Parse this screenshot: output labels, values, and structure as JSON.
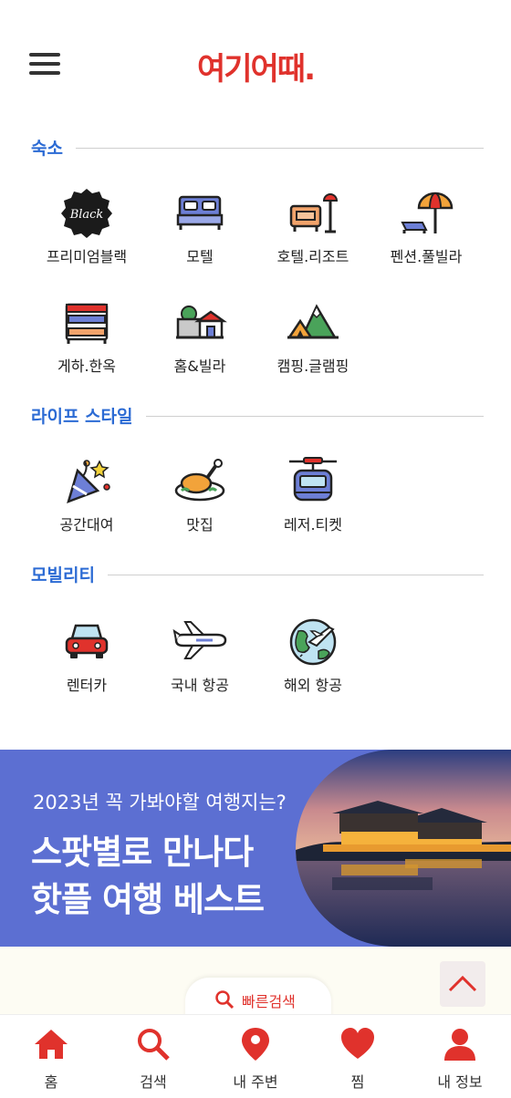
{
  "app": {
    "logo_text": "여기어때."
  },
  "sections": [
    {
      "title": "숙소",
      "items": [
        {
          "label": "프리미엄블랙",
          "icon": "black-badge-icon",
          "badge_text": "Black"
        },
        {
          "label": "모텔",
          "icon": "bed-icon"
        },
        {
          "label": "호텔.리조트",
          "icon": "sofa-lamp-icon"
        },
        {
          "label": "펜션.풀빌라",
          "icon": "beach-umbrella-icon"
        },
        {
          "label": "게하.한옥",
          "icon": "bunk-bed-icon"
        },
        {
          "label": "홈&빌라",
          "icon": "house-icon"
        },
        {
          "label": "캠핑.글램핑",
          "icon": "tent-mountain-icon"
        }
      ]
    },
    {
      "title": "라이프 스타일",
      "items": [
        {
          "label": "공간대여",
          "icon": "party-popper-icon"
        },
        {
          "label": "맛집",
          "icon": "roast-chicken-icon"
        },
        {
          "label": "레저.티켓",
          "icon": "cable-car-icon"
        }
      ]
    },
    {
      "title": "모빌리티",
      "items": [
        {
          "label": "렌터카",
          "icon": "car-icon"
        },
        {
          "label": "국내 항공",
          "icon": "airplane-icon"
        },
        {
          "label": "해외 항공",
          "icon": "globe-plane-icon"
        }
      ]
    }
  ],
  "banner": {
    "subtitle": "2023년 꼭 가봐야할 여행지는?",
    "title_line1": "스팟별로 만나다",
    "title_line2": "핫플 여행 베스트",
    "background_color": "#5c6fd2"
  },
  "quick_search": {
    "label": "빠른검색"
  },
  "bottom_nav": [
    {
      "label": "홈",
      "icon": "home-icon"
    },
    {
      "label": "검색",
      "icon": "search-icon"
    },
    {
      "label": "내 주변",
      "icon": "location-pin-icon"
    },
    {
      "label": "찜",
      "icon": "heart-icon"
    },
    {
      "label": "내 정보",
      "icon": "user-icon"
    }
  ],
  "colors": {
    "brand": "#e0322c",
    "section_title": "#2c6bd4"
  }
}
